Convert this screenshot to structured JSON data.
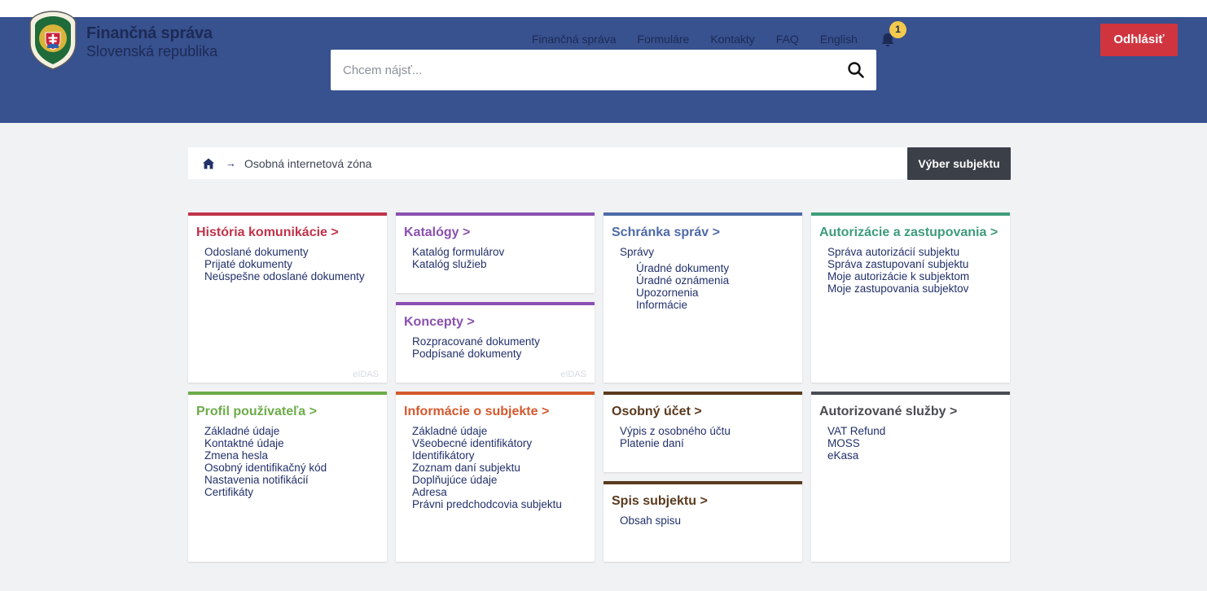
{
  "brand": {
    "name": "Finančná správa",
    "country": "Slovenská republika",
    "logo_text": "FINANČNÁ SPRÁVA SLOVENSKÁ REPUBLIKA"
  },
  "topnav": [
    {
      "label": "Finančná správa"
    },
    {
      "label": "Formuláre"
    },
    {
      "label": "Kontakty"
    },
    {
      "label": "FAQ"
    },
    {
      "label": "English"
    }
  ],
  "notifications": {
    "count": "1"
  },
  "logout_label": "Odhlásiť",
  "search": {
    "placeholder": "Chcem nájsť..."
  },
  "breadcrumb": {
    "current": "Osobná internetová zóna"
  },
  "subject_button": "Výber subjektu",
  "cards": {
    "historia": {
      "title": "História komunikácie >",
      "color": "#c0334a",
      "items": [
        "Odoslané dokumenty",
        "Prijaté dokumenty",
        "Neúspešne odoslané dokumenty"
      ],
      "eidas": "eIDAS"
    },
    "katalogy": {
      "title": "Katalógy >",
      "color": "#8a50b0",
      "items": [
        "Katalóg formulárov",
        "Katalóg služieb"
      ]
    },
    "koncepty": {
      "title": "Koncepty >",
      "color": "#8a50b0",
      "items": [
        "Rozpracované dokumenty",
        "Podpísané dokumenty"
      ],
      "eidas": "eIDAS"
    },
    "schranka": {
      "title": "Schránka správ >",
      "color": "#4e6aa6",
      "items": [
        "Správy"
      ],
      "subitems": [
        "Úradné dokumenty",
        "Úradné oznámenia",
        "Upozornenia",
        "Informácie"
      ]
    },
    "autorizacie": {
      "title": "Autorizácie a zastupovania >",
      "color": "#3e9c7a",
      "items": [
        "Správa autorizácií subjektu",
        "Správa zastupovaní subjektu",
        "Moje autorizácie k subjektom",
        "Moje zastupovania subjektov"
      ]
    },
    "profil": {
      "title": "Profil používateľa >",
      "color": "#6cab4a",
      "items": [
        "Základné údaje",
        "Kontaktné údaje",
        "Zmena hesla",
        "Osobný identifikačný kód",
        "Nastavenia notifikácií",
        "Certifikáty"
      ]
    },
    "informacie": {
      "title": "Informácie o subjekte >",
      "color": "#d3592e",
      "items": [
        "Základné údaje",
        "Všeobecné identifikátory",
        "Identifikátory",
        "Zoznam daní subjektu",
        "Doplňujúce údaje",
        "Adresa",
        "Právni predchodcovia subjektu"
      ]
    },
    "ucet": {
      "title": "Osobný účet >",
      "color": "#5a3a1e",
      "items": [
        "Výpis z osobného účtu",
        "Platenie daní"
      ]
    },
    "spis": {
      "title": "Spis subjektu >",
      "color": "#5a3a1e",
      "items": [
        "Obsah spisu"
      ]
    },
    "sluzby": {
      "title": "Autorizované služby >",
      "color": "#4a4c52",
      "items": [
        "VAT Refund",
        "MOSS",
        "eKasa"
      ]
    }
  }
}
